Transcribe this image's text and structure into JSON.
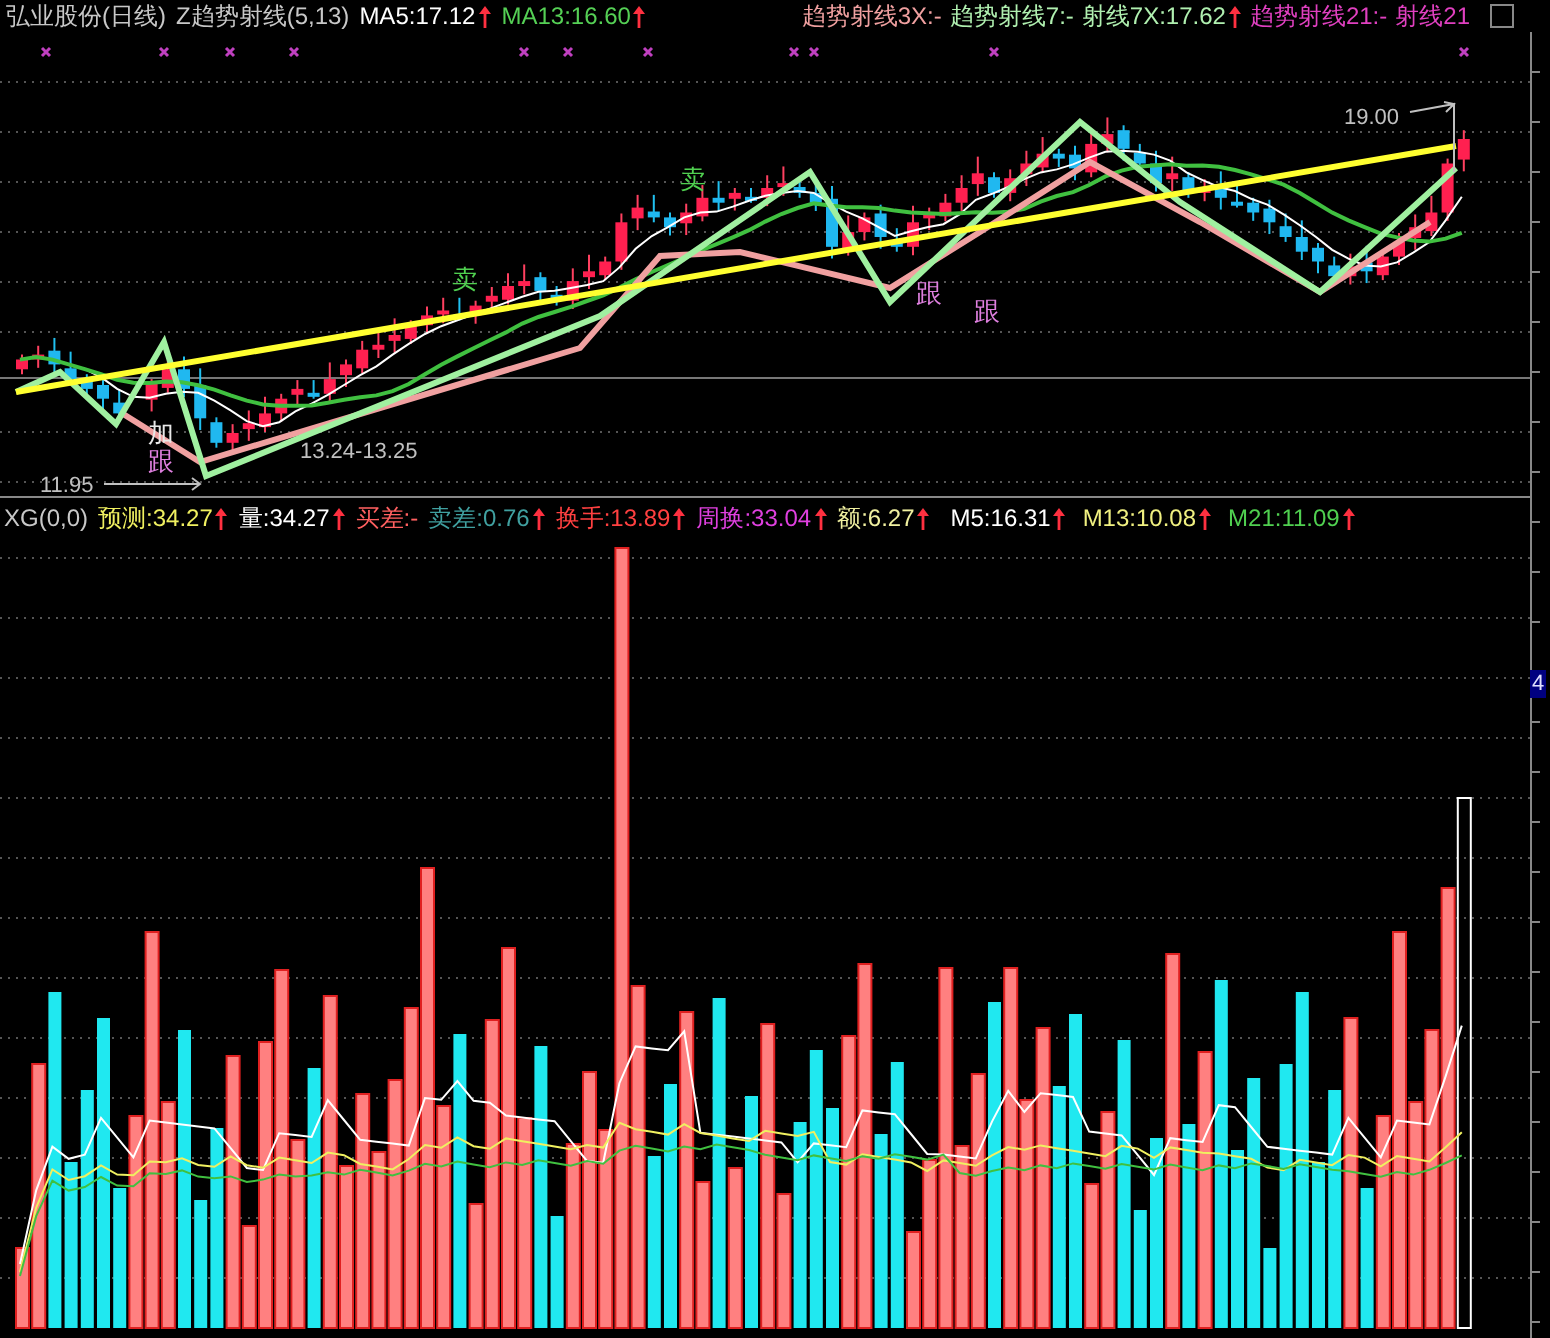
{
  "header": {
    "left": [
      {
        "text": "弘业股份(日线)",
        "color": "#c8c8c8",
        "arrow": false
      },
      {
        "text": "Z趋势射线(5,13)",
        "color": "#c8c8c8",
        "arrow": false
      },
      {
        "text": "MA5:17.12",
        "color": "#ffffff",
        "arrow": true
      },
      {
        "text": "MA13:16.60",
        "color": "#55d055",
        "arrow": true
      }
    ],
    "right": [
      {
        "text": "趋势射线3X:-",
        "color": "#f0a0a0",
        "arrow": false
      },
      {
        "text": "趋势射线7:-",
        "color": "#b0f0b0",
        "arrow": false
      },
      {
        "text": "射线7X:17.62",
        "color": "#b0f0b0",
        "arrow": true
      },
      {
        "text": "趋势射线21:-",
        "color": "#e040c0",
        "arrow": false
      },
      {
        "text": "射线21",
        "color": "#e040c0",
        "arrow": false
      }
    ]
  },
  "annotations": [
    {
      "text": "卖",
      "color": "#50d050"
    },
    {
      "text": "卖",
      "color": "#50d050"
    },
    {
      "text": "加",
      "color": "#e8e8e8"
    },
    {
      "text": "跟",
      "color": "#e080e0"
    },
    {
      "text": "跟",
      "color": "#e080e0"
    },
    {
      "text": "跟",
      "color": "#e080e0"
    },
    {
      "text": "13.24-13.25",
      "color": "#c0c0c0"
    },
    {
      "text": "11.95",
      "color": "#c0c0c0"
    },
    {
      "text": "19.00",
      "color": "#c0c0c0"
    }
  ],
  "volume_header": {
    "left": [
      {
        "text": "XG(0,0)",
        "color": "#c8c8c8",
        "arrow": false
      },
      {
        "text": "预测:34.27",
        "color": "#f0f060",
        "arrow": true
      },
      {
        "text": "量:34.27",
        "color": "#ffffff",
        "arrow": true
      },
      {
        "text": "买差:-",
        "color": "#ff6060",
        "arrow": false
      },
      {
        "text": "卖差:0.76",
        "color": "#40a0a0",
        "arrow": true
      },
      {
        "text": "换手:13.89",
        "color": "#ff4040",
        "arrow": true
      },
      {
        "text": "周换:33.04",
        "color": "#e040e0",
        "arrow": true
      },
      {
        "text": "额:6.27",
        "color": "#f0f0a0",
        "arrow": true
      }
    ],
    "right": [
      {
        "text": "M5:16.31",
        "color": "#ffffff",
        "arrow": true
      },
      {
        "text": "M13:10.08",
        "color": "#f0f080",
        "arrow": true
      },
      {
        "text": "M21:11.09",
        "color": "#50d050",
        "arrow": true
      }
    ]
  },
  "axis_label": "4"
}
